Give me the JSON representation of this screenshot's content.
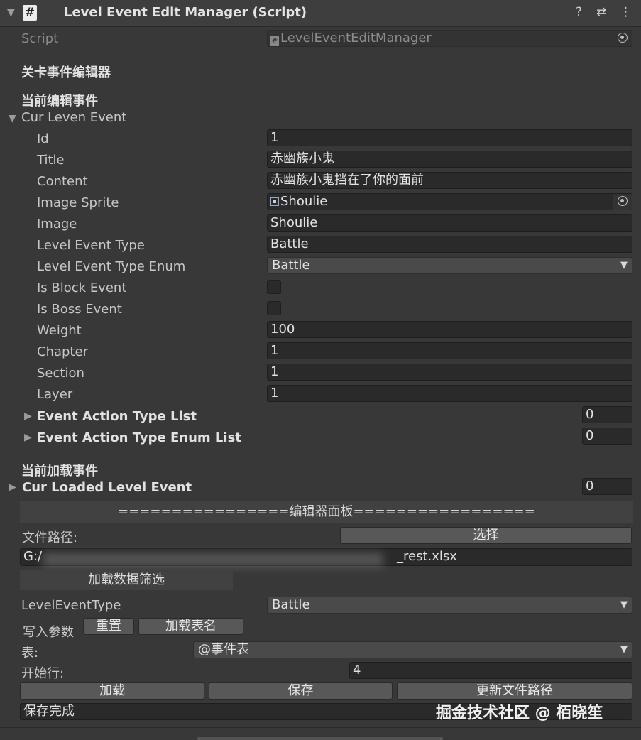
{
  "header": {
    "title": "Level Event Edit Manager (Script)",
    "icon_hash": "#",
    "help_icon": "?",
    "settings_icon": "⇄",
    "more_icon": "⋮"
  },
  "script": {
    "label": "Script",
    "value": "LevelEventEditManager"
  },
  "sections": {
    "editor_title": "关卡事件编辑器",
    "current_edit": "当前编辑事件",
    "current_loaded": "当前加载事件"
  },
  "cur_event": {
    "label": "Cur Leven Event",
    "fields": {
      "id": {
        "label": "Id",
        "value": "1"
      },
      "title": {
        "label": "Title",
        "value": "赤幽族小鬼"
      },
      "content": {
        "label": "Content",
        "value": "赤幽族小鬼挡在了你的面前"
      },
      "image_sprite": {
        "label": "Image Sprite",
        "value": "Shoulie"
      },
      "image": {
        "label": "Image",
        "value": "Shoulie"
      },
      "level_event_type": {
        "label": "Level Event Type",
        "value": "Battle"
      },
      "level_event_type_enum": {
        "label": "Level Event Type Enum",
        "value": "Battle"
      },
      "is_block_event": {
        "label": "Is Block Event",
        "checked": false
      },
      "is_boss_event": {
        "label": "Is Boss Event",
        "checked": false
      },
      "weight": {
        "label": "Weight",
        "value": "100"
      },
      "chapter": {
        "label": "Chapter",
        "value": "1"
      },
      "section": {
        "label": "Section",
        "value": "1"
      },
      "layer": {
        "label": "Layer",
        "value": "1"
      }
    },
    "lists": {
      "action_type": {
        "label": "Event Action Type List",
        "count": "0"
      },
      "action_type_enum": {
        "label": "Event Action Type Enum List",
        "count": "0"
      }
    }
  },
  "cur_loaded": {
    "label": "Cur Loaded Level Event",
    "count": "0"
  },
  "panel": {
    "banner": "================编辑器面板=================",
    "file_path_label": "文件路径:",
    "select_button": "选择",
    "file_path_value": "G:/ ",
    "file_path_tail": "_rest.xlsx",
    "load_filter_button": "加载数据筛选",
    "level_event_type_label": "LevelEventType",
    "level_event_type_value": "Battle",
    "write_params_label": "写入参数",
    "reset_button": "重置",
    "load_sheet_button": "加载表名",
    "sheet_label": "表:",
    "sheet_value": "@事件表",
    "start_row_label": "开始行:",
    "start_row_value": "4",
    "load_button": "加载",
    "save_button": "保存",
    "update_path_button": "更新文件路径",
    "status": "保存完成"
  },
  "watermark": "掘金技术社区 @ 栢晓笙",
  "colors": {
    "background": "#383838",
    "field": "#2a2a2a",
    "button": "#585858",
    "dropdown": "#4a4a4a"
  }
}
